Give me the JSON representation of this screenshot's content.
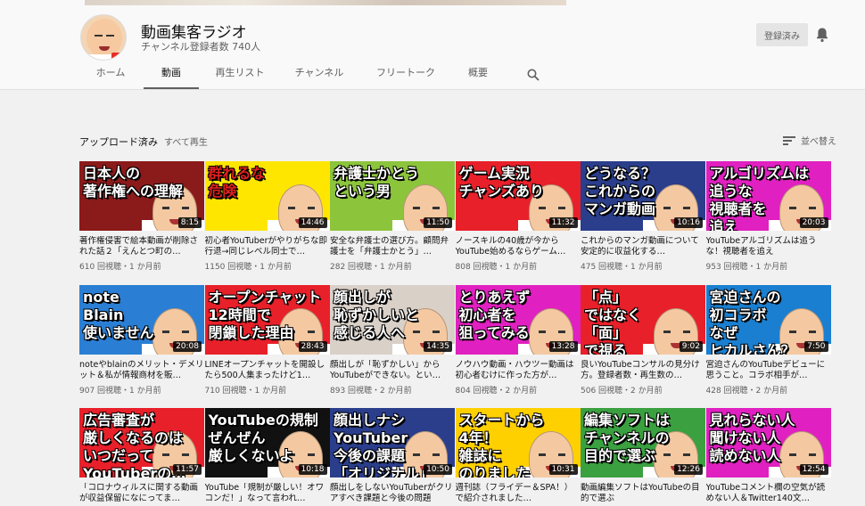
{
  "channel": {
    "name": "動画集客ラジオ",
    "subscribers": "チャンネル登録者数 740人",
    "subscribed_label": "登録済み"
  },
  "tabs": [
    "ホーム",
    "動画",
    "再生リスト",
    "チャンネル",
    "フリートーク",
    "概要"
  ],
  "active_tab": "動画",
  "section": {
    "title": "アップロード済み",
    "play_all": "すべて再生",
    "sort_label": "並べ替え"
  },
  "videos": [
    {
      "thumb_text": "日本人の\n著作権への理解",
      "bg": "#8b1a1a",
      "text_color": "#ffffff",
      "duration": "8:15",
      "title": "著作権侵害で絵本動画が削除された話２「えんとつ町の…",
      "meta": "610 回視聴・1 か月前"
    },
    {
      "thumb_text": "群れるな\n危険",
      "bg": "#ffe600",
      "text_color": "#e02020",
      "duration": "14:46",
      "title": "初心者YouTuberがやりがちな即行退→同じレベル同士で…",
      "meta": "1150 回視聴・1 か月前"
    },
    {
      "thumb_text": "弁護士かとう\nという男",
      "bg": "#8cc43c",
      "text_color": "#ffffff",
      "duration": "11:50",
      "title": "安全な弁護士の選び方。顧問弁護士を「弁護士かとう」…",
      "meta": "282 回視聴・1 か月前"
    },
    {
      "thumb_text": "ゲーム実況\nチャンズあり",
      "bg": "#e8202a",
      "text_color": "#ffffff",
      "duration": "11:32",
      "title": "ノースキルの40歳が今からYouTube始めるならゲーム…",
      "meta": "808 回視聴・1 か月前"
    },
    {
      "thumb_text": "どうなる？\nこれからの\nマンガ動画",
      "bg": "#2a3e8c",
      "text_color": "#ffffff",
      "duration": "10:16",
      "title": "これからのマンガ動画について　安定的に収益化する…",
      "meta": "475 回視聴・1 か月前"
    },
    {
      "thumb_text": "アルゴリズムは\n追うな\n視聴者を\n追え",
      "bg": "#e020c0",
      "text_color": "#ffffff",
      "duration": "20:03",
      "title": "YouTubeアルゴリズムは追うな！視聴者を追え",
      "meta": "953 回視聴・1 か月前"
    },
    {
      "thumb_text": "note\nBlain\n使いません",
      "bg": "#2a7fd4",
      "text_color": "#ffffff",
      "duration": "20:08",
      "title": "noteやblainのメリット・デメリット＆私が情報商材を販…",
      "meta": "907 回視聴・1 か月前"
    },
    {
      "thumb_text": "オープンチャット\n12時間で\n閉鎖した理由",
      "bg": "#e8202a",
      "text_color": "#ffffff",
      "duration": "28:43",
      "title": "LINEオープンチャットを開設したら500人集まったけど1…",
      "meta": "710 回視聴・1 か月前"
    },
    {
      "thumb_text": "顔出しが\n恥ずかしいと\n感じる人へ",
      "bg": "#d9d0c8",
      "text_color": "#ffffff",
      "duration": "14:35",
      "title": "顔出しが「恥ずかしい」からYouTubeができない。とい…",
      "meta": "893 回視聴・2 か月前"
    },
    {
      "thumb_text": "とりあえず\n初心者を\n狙ってみる",
      "bg": "#e020c0",
      "text_color": "#ffffff",
      "duration": "13:28",
      "title": "ノウハウ動画・ハウツー動画は初心者むけに作った方が…",
      "meta": "804 回視聴・2 か月前"
    },
    {
      "thumb_text": "「点」\nではなく\n「面」\nで視る",
      "bg": "#e8202a",
      "text_color": "#ffffff",
      "duration": "9:02",
      "title": "良いYouTubeコンサルの見分け方。登録者数・再生数の…",
      "meta": "506 回視聴・2 か月前"
    },
    {
      "thumb_text": "宮迫さんの\n初コラボ\nなぜ\nヒカルさん？",
      "bg": "#1a7fd0",
      "text_color": "#ffffff",
      "duration": "7:50",
      "title": "宮迫さんのYouTubeデビューに思うこと。コラボ相手が…",
      "meta": "428 回視聴・2 か月前"
    },
    {
      "thumb_text": "広告審査が\n厳しくなるのは\nいつだって\nYouTuberの…",
      "bg": "#e8202a",
      "text_color": "#ffffff",
      "duration": "11:57",
      "title": "「コロナウィルスに関する動画が収益保留になにってま…",
      "meta": ""
    },
    {
      "thumb_text": "YouTubeの規制\nぜんぜん\n厳しくないよ",
      "bg": "#111111",
      "text_color": "#ffffff",
      "duration": "10:18",
      "title": "YouTube「規制が厳しい！オワコンだ！」なって言われ…",
      "meta": ""
    },
    {
      "thumb_text": "顔出しナシ\nYouTuber\n今後の課題\n「オリジナル」",
      "bg": "#2a3e8c",
      "text_color": "#ffffff",
      "duration": "10:50",
      "title": "顔出しをしないYouTuberがクリアすべき課題と今後の問題",
      "meta": ""
    },
    {
      "thumb_text": "スタートから\n4年！\n雑誌に\nのりました",
      "bg": "#ffd000",
      "text_color": "#ffffff",
      "duration": "10:31",
      "title": "週刊誌（フライデー＆SPA！）で紹介されました…",
      "meta": ""
    },
    {
      "thumb_text": "編集ソフトは\nチャンネルの\n目的で選ぶ",
      "bg": "#3aa040",
      "text_color": "#ffffff",
      "duration": "12:26",
      "title": "動画編集ソフトはYouTubeの目的で選ぶ",
      "meta": ""
    },
    {
      "thumb_text": "見れらない人\n聞けない人\n読めない人",
      "bg": "#e020c0",
      "text_color": "#ffffff",
      "duration": "12:54",
      "title": "YouTubeコメント欄の空気が読めない人＆Twitter140文…",
      "meta": ""
    }
  ]
}
